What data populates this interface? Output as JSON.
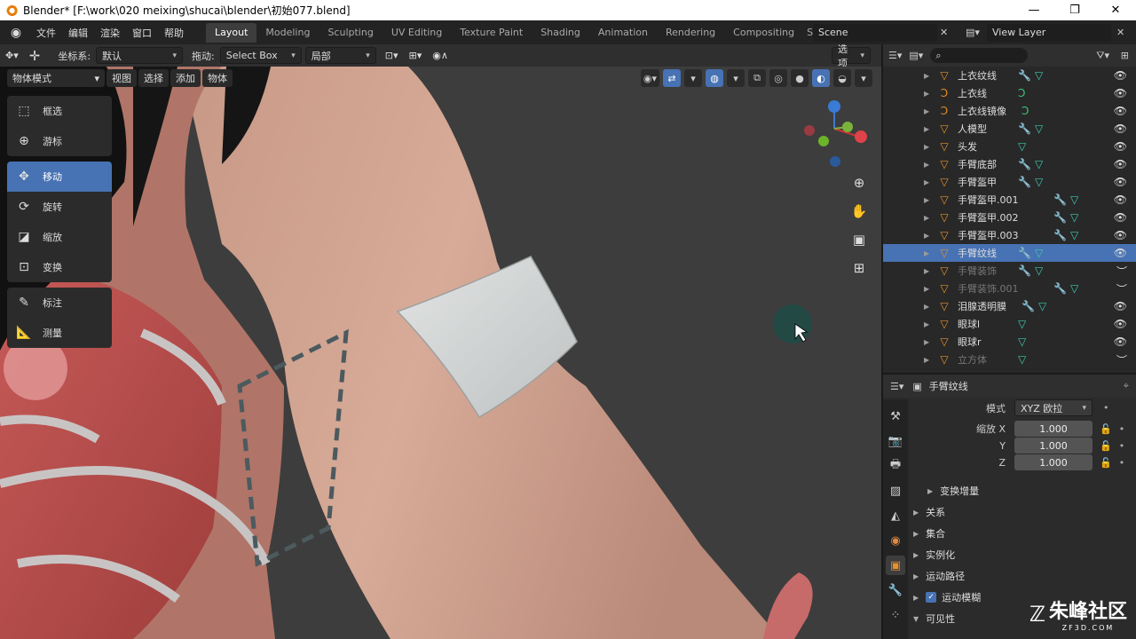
{
  "window": {
    "title": "Blender* [F:\\work\\020 meixing\\shucai\\blender\\初始077.blend]",
    "min": "—",
    "max": "❐",
    "close": "✕"
  },
  "menu": [
    "文件",
    "编辑",
    "渲染",
    "窗口",
    "帮助"
  ],
  "workspaces": [
    "Layout",
    "Modeling",
    "Sculpting",
    "UV Editing",
    "Texture Paint",
    "Shading",
    "Animation",
    "Rendering",
    "Compositing",
    "Sc"
  ],
  "scene": {
    "name": "Scene",
    "view_layer": "View Layer"
  },
  "vp_header": {
    "coord_label": "坐标系:",
    "coord_value": "默认",
    "drag_label": "拖动:",
    "drag_value": "Select Box",
    "pivot_value": "局部",
    "options": "选项"
  },
  "mode": {
    "mode": "物体模式",
    "view": "视图",
    "select": "选择",
    "add": "添加",
    "object": "物体"
  },
  "tools": [
    [
      "框选",
      "游标"
    ],
    [
      "移动",
      "旋转",
      "缩放",
      "变换"
    ],
    [
      "标注",
      "测量"
    ]
  ],
  "tool_icons": {
    "select": "select-box-icon",
    "cursor": "cursor-icon",
    "move": "move-icon",
    "rotate": "rotate-icon",
    "scale": "scale-icon",
    "transform": "transform-icon",
    "annotate": "annotate-icon",
    "measure": "measure-icon"
  },
  "outliner": [
    {
      "name": "上衣纹线",
      "icon": "mesh",
      "mod": true,
      "sel": false,
      "dim": false
    },
    {
      "name": "上衣线",
      "icon": "curve",
      "mod": false,
      "sel": false,
      "dim": false
    },
    {
      "name": "上衣线镜像",
      "icon": "curve",
      "mod": false,
      "sel": false,
      "dim": false
    },
    {
      "name": "人模型",
      "icon": "mesh",
      "mod": true,
      "sel": false,
      "dim": false
    },
    {
      "name": "头发",
      "icon": "mesh",
      "mod": false,
      "sel": false,
      "dim": false
    },
    {
      "name": "手臂底部",
      "icon": "mesh",
      "mod": true,
      "sel": false,
      "dim": false
    },
    {
      "name": "手臂盔甲",
      "icon": "mesh",
      "mod": true,
      "sel": false,
      "dim": false
    },
    {
      "name": "手臂盔甲.001",
      "icon": "mesh",
      "mod": true,
      "sel": false,
      "dim": false
    },
    {
      "name": "手臂盔甲.002",
      "icon": "mesh",
      "mod": true,
      "sel": false,
      "dim": false
    },
    {
      "name": "手臂盔甲.003",
      "icon": "mesh",
      "mod": true,
      "sel": false,
      "dim": false
    },
    {
      "name": "手臂纹线",
      "icon": "mesh",
      "mod": true,
      "sel": true,
      "dim": false
    },
    {
      "name": "手臂装饰",
      "icon": "mesh",
      "mod": true,
      "sel": false,
      "dim": true
    },
    {
      "name": "手臂装饰.001",
      "icon": "mesh",
      "mod": true,
      "sel": false,
      "dim": true
    },
    {
      "name": "泪腺透明膜",
      "icon": "mesh",
      "mod": true,
      "sel": false,
      "dim": false
    },
    {
      "name": "眼球l",
      "icon": "mesh",
      "mod": false,
      "sel": false,
      "dim": false
    },
    {
      "name": "眼球r",
      "icon": "mesh",
      "mod": false,
      "sel": false,
      "dim": false
    },
    {
      "name": "立方体",
      "icon": "mesh",
      "mod": false,
      "sel": false,
      "dim": true
    }
  ],
  "properties": {
    "object_name": "手臂纹线",
    "mode_label": "模式",
    "mode_value": "XYZ 欧拉",
    "scale_x_label": "缩放 X",
    "scale_y_label": "Y",
    "scale_z_label": "Z",
    "scale_x": "1.000",
    "scale_y": "1.000",
    "scale_z": "1.000",
    "delta": "变换增量",
    "panels": [
      "关系",
      "集合",
      "实例化",
      "运动路径",
      "运动模糊",
      "可见性"
    ]
  },
  "watermark": {
    "line1": "朱峰社区",
    "line2": "ZF3D.COM"
  }
}
